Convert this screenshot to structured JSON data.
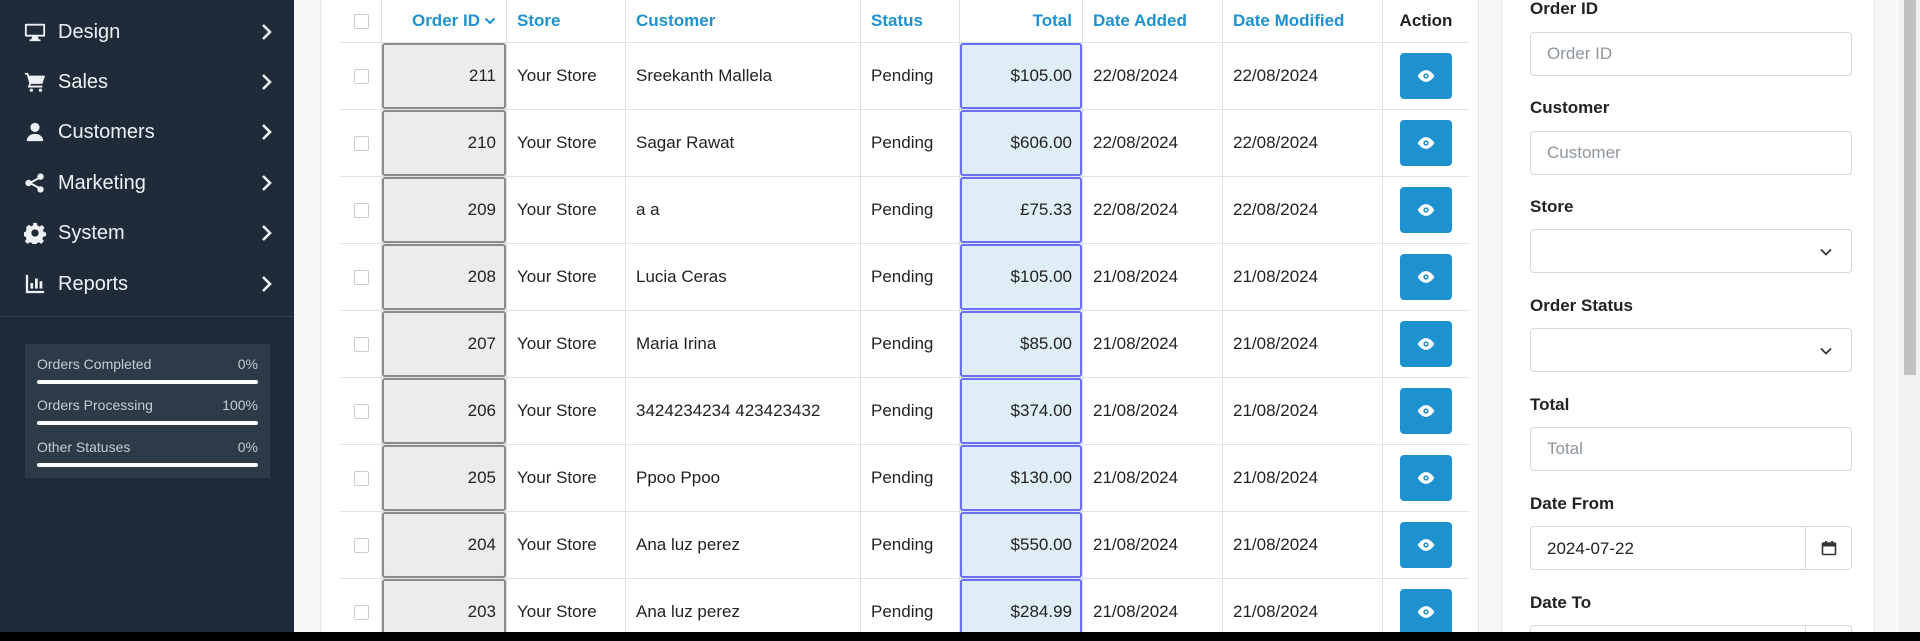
{
  "sidebar": {
    "items": [
      {
        "label": "Design",
        "icon": "monitor-icon"
      },
      {
        "label": "Sales",
        "icon": "cart-icon"
      },
      {
        "label": "Customers",
        "icon": "user-icon"
      },
      {
        "label": "Marketing",
        "icon": "share-icon"
      },
      {
        "label": "System",
        "icon": "gear-icon"
      },
      {
        "label": "Reports",
        "icon": "chart-icon"
      }
    ],
    "stats": [
      {
        "name": "Orders Completed",
        "value": "0%"
      },
      {
        "name": "Orders Processing",
        "value": "100%"
      },
      {
        "name": "Other Statuses",
        "value": "0%"
      }
    ]
  },
  "table": {
    "headers": {
      "order_id": "Order ID",
      "store": "Store",
      "customer": "Customer",
      "status": "Status",
      "total": "Total",
      "date_added": "Date Added",
      "date_modified": "Date Modified",
      "action": "Action"
    },
    "rows": [
      {
        "id": "211",
        "store": "Your Store",
        "customer": "Sreekanth Mallela",
        "status": "Pending",
        "total": "$105.00",
        "added": "22/08/2024",
        "modified": "22/08/2024"
      },
      {
        "id": "210",
        "store": "Your Store",
        "customer": "Sagar Rawat",
        "status": "Pending",
        "total": "$606.00",
        "added": "22/08/2024",
        "modified": "22/08/2024"
      },
      {
        "id": "209",
        "store": "Your Store",
        "customer": "a a",
        "status": "Pending",
        "total": "£75.33",
        "added": "22/08/2024",
        "modified": "22/08/2024"
      },
      {
        "id": "208",
        "store": "Your Store",
        "customer": "Lucia Ceras",
        "status": "Pending",
        "total": "$105.00",
        "added": "21/08/2024",
        "modified": "21/08/2024"
      },
      {
        "id": "207",
        "store": "Your Store",
        "customer": "Maria Irina",
        "status": "Pending",
        "total": "$85.00",
        "added": "21/08/2024",
        "modified": "21/08/2024"
      },
      {
        "id": "206",
        "store": "Your Store",
        "customer": "3424234234 423423432",
        "status": "Pending",
        "total": "$374.00",
        "added": "21/08/2024",
        "modified": "21/08/2024"
      },
      {
        "id": "205",
        "store": "Your Store",
        "customer": "Ppoo Ppoo",
        "status": "Pending",
        "total": "$130.00",
        "added": "21/08/2024",
        "modified": "21/08/2024"
      },
      {
        "id": "204",
        "store": "Your Store",
        "customer": "Ana luz perez",
        "status": "Pending",
        "total": "$550.00",
        "added": "21/08/2024",
        "modified": "21/08/2024"
      },
      {
        "id": "203",
        "store": "Your Store",
        "customer": "Ana luz perez",
        "status": "Pending",
        "total": "$284.99",
        "added": "21/08/2024",
        "modified": "21/08/2024"
      }
    ]
  },
  "filter": {
    "order_id": {
      "label": "Order ID",
      "placeholder": "Order ID"
    },
    "customer": {
      "label": "Customer",
      "placeholder": "Customer"
    },
    "store": {
      "label": "Store",
      "value": ""
    },
    "order_status": {
      "label": "Order Status",
      "value": ""
    },
    "total": {
      "label": "Total",
      "placeholder": "Total"
    },
    "date_from": {
      "label": "Date From",
      "value": "2024-07-22"
    },
    "date_to": {
      "label": "Date To"
    }
  },
  "colors": {
    "sidebar_bg": "#1f2b38",
    "link_blue": "#1e91cf",
    "total_highlight": "#6a6ff3",
    "id_highlight": "#8b8b8b"
  }
}
